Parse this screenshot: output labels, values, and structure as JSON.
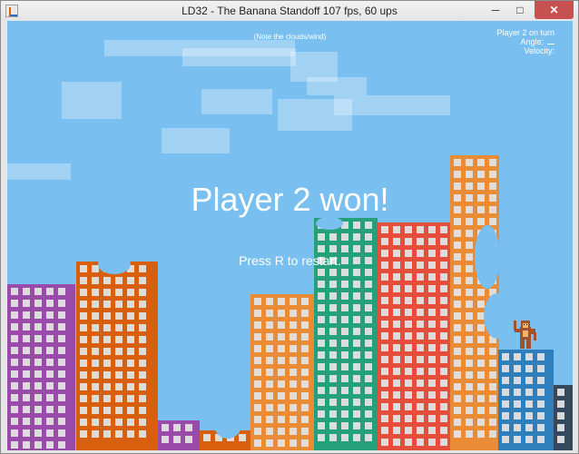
{
  "window": {
    "title": "LD32 - The Banana Standoff   107 fps,   60 ups",
    "controls": {
      "minimize": "─",
      "maximize": "□",
      "close": "✕"
    }
  },
  "hud": {
    "note": "(Note the clouds/wind)",
    "status": {
      "turn": "Player 2 on turn",
      "angle_label": "Angle:",
      "velocity_label": "Velocity:"
    }
  },
  "game": {
    "result_message": "Player 2 won!",
    "restart_hint": "Press R to restart."
  },
  "colors": {
    "sky": "#79bff0",
    "purple": "#9a4aa8",
    "orange_dark": "#d85f0e",
    "orange": "#ea8b35",
    "green": "#24a07a",
    "red": "#e54e3b",
    "blue": "#2f7fbd",
    "slate": "#34495e"
  },
  "icons": {
    "monkey": "monkey-icon"
  }
}
